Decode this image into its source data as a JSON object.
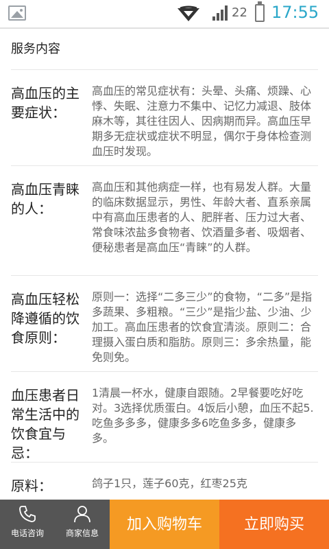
{
  "status_bar": {
    "signal_number": "22",
    "time": "17:55"
  },
  "content": {
    "section_title": "服务内容",
    "rows": [
      {
        "label": "高血压的主要症状：",
        "text": "高血压的常见症状有：头晕、头痛、烦躁、心悸、失眠、注意力不集中、记忆力减退、肢体麻木等，其往往因人、因病期而异。高血压早期多无症状或症状不明显，偶尔于身体检查测血压时发现。"
      },
      {
        "label": "高血压青睐的人：",
        "text": "高血压和其他病症一样，也有易发人群。大量的临床数据显示，男性、年龄大者、直系亲属中有高血压患者的人、肥胖者、压力过大者、常食味浓盐多食物者、饮酒量多者、吸烟者、便秘患者是高血压“青睐”的人群。"
      },
      {
        "label": " 高血压轻松降遵循的饮食原则：",
        "text": "原则一：选择“二多三少”的食物，“二多”是指多蔬果、多粗粮。“三少”是指少盐、少油、少加工。高血压患者的饮食宜清淡。原则二：合理摄入蛋白质和脂肪。原则三：多余热量，能免则免。"
      },
      {
        "label": "血压患者日常生活中的饮食宜与忌：",
        "text": "1清晨一杯水，健康自跟随。2早餐要吃好吃对。3选择优质蛋白。4饭后小憩，血压不起5.吃鱼多多多，健康多多6吃鱼多多，健康多多。"
      },
      {
        "label": "原料：",
        "text": "鸽子1只，莲子60克，红枣25克"
      }
    ]
  },
  "bottom_bar": {
    "phone_label": "电话咨询",
    "merchant_label": "商家信息",
    "cart_label": "加入购物车",
    "buy_label": "立即购买"
  },
  "colors": {
    "time": "#2aa7c9",
    "cart": "#f59a23",
    "buy": "#f57121",
    "bottom_dark": "#555555"
  },
  "icons": {
    "image": "image-icon",
    "wifi": "wifi-icon",
    "signal": "signal-icon",
    "battery": "battery-icon",
    "phone": "phone-icon",
    "person": "person-icon"
  }
}
